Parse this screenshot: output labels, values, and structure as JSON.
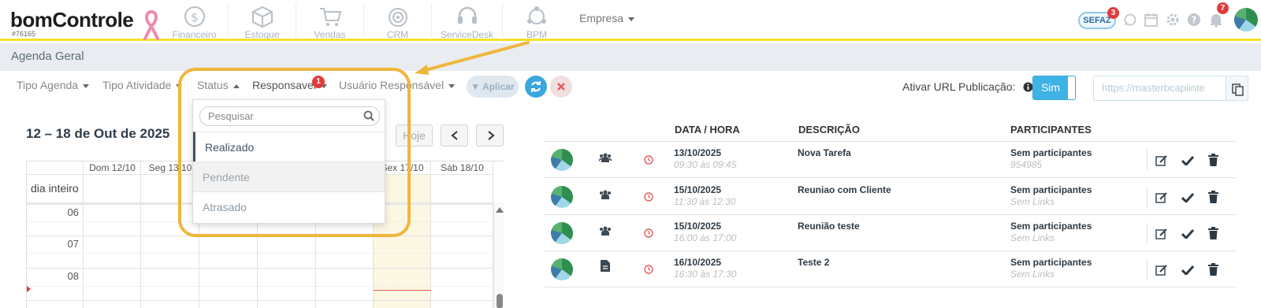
{
  "topbar": {
    "logo": "bomControle",
    "account_id": "#76165",
    "nav": [
      {
        "label": "Financeiro",
        "icon": "dollar-coin-icon"
      },
      {
        "label": "Estoque",
        "icon": "box-icon"
      },
      {
        "label": "Vendas",
        "icon": "cart-icon"
      },
      {
        "label": "CRM",
        "icon": "target-icon"
      },
      {
        "label": "ServiceDesk",
        "icon": "headset-icon"
      },
      {
        "label": "BPM",
        "icon": "network-icon"
      }
    ],
    "empresa": "Empresa",
    "sefaz": "SEFAZ",
    "sefaz_badge": "3",
    "notif_badge": "7"
  },
  "page_title": "Agenda Geral",
  "filters": {
    "tipo_agenda": "Tipo Agenda",
    "tipo_atividade": "Tipo Atividade",
    "status": "Status",
    "responsavel": "Responsavel",
    "responsavel_badge": "1",
    "usuario_responsavel": "Usuário Responsável",
    "aplicar": "Aplicar"
  },
  "publish": {
    "label": "Ativar URL Publicação:",
    "toggle": "Sim",
    "url": "https://masterbcapiinte"
  },
  "status_dropdown": {
    "placeholder": "Pesquisar",
    "options": [
      "Realizado",
      "Pendente",
      "Atrasado"
    ]
  },
  "calendar": {
    "range": "12 – 18 de Out de 2025",
    "today": "Hoje",
    "days": [
      "Dom 12/10",
      "Seg 13/10",
      "",
      "",
      "",
      "Sex 17/10",
      "Sáb 18/10"
    ],
    "all_day": "dia inteiro",
    "hours": [
      "06",
      "07",
      "08"
    ]
  },
  "table": {
    "headers": [
      "DATA / HORA",
      "DESCRIÇÃO",
      "PARTICIPANTES"
    ],
    "rows": [
      {
        "date": "13/10/2025",
        "time": "09:30 às 09:45",
        "desc": "Nova Tarefa",
        "part": "Sem participantes",
        "sub": "954985",
        "type_icon": "group-icon"
      },
      {
        "date": "15/10/2025",
        "time": "11:30 às 12:30",
        "desc": "Reuniao com Cliente",
        "part": "Sem participantes",
        "sub": "Sem Links",
        "type_icon": "group-icon"
      },
      {
        "date": "15/10/2025",
        "time": "16:00 às 17:00",
        "desc": "Reunião teste",
        "part": "Sem participantes",
        "sub": "Sem Links",
        "type_icon": "group-icon"
      },
      {
        "date": "16/10/2025",
        "time": "16:30 às 17:30",
        "desc": "Teste 2",
        "part": "Sem participantes",
        "sub": "Sem Links",
        "type_icon": "document-icon"
      }
    ]
  },
  "colors": {
    "accent": "#3fb2e6",
    "highlight": "#f0b63b",
    "topline": "#f2e12b",
    "badge": "#e03b3b"
  }
}
